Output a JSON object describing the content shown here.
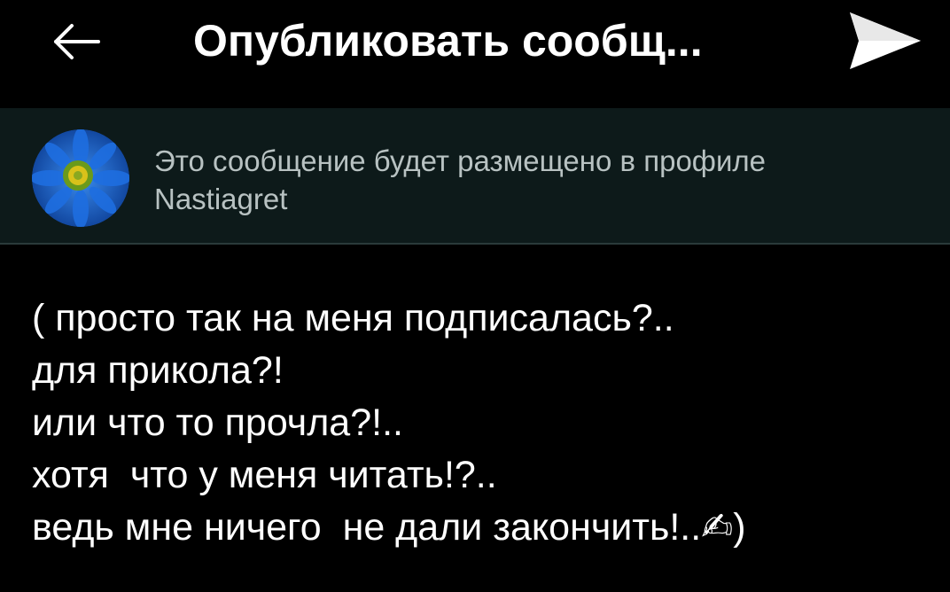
{
  "header": {
    "title": "Опубликовать сообщ...",
    "back_icon": "arrow-left-icon",
    "send_icon": "send-icon"
  },
  "profile": {
    "notice": "Это сообщение будет размещено в профиле",
    "username": "Nastiagret",
    "avatar_icon": "avatar-blue-flower"
  },
  "message": {
    "lines": [
      "( просто так на меня подписалась?..",
      "для прикола?!",
      "или что то прочла?!..",
      "хотя  что у меня читать!?..",
      "ведь мне ничего  не дали закончить!..✍)"
    ]
  },
  "colors": {
    "background": "#000000",
    "profile_bar": "#0d1a1a",
    "text_primary": "#ffffff",
    "text_secondary": "#b8c2c2"
  }
}
